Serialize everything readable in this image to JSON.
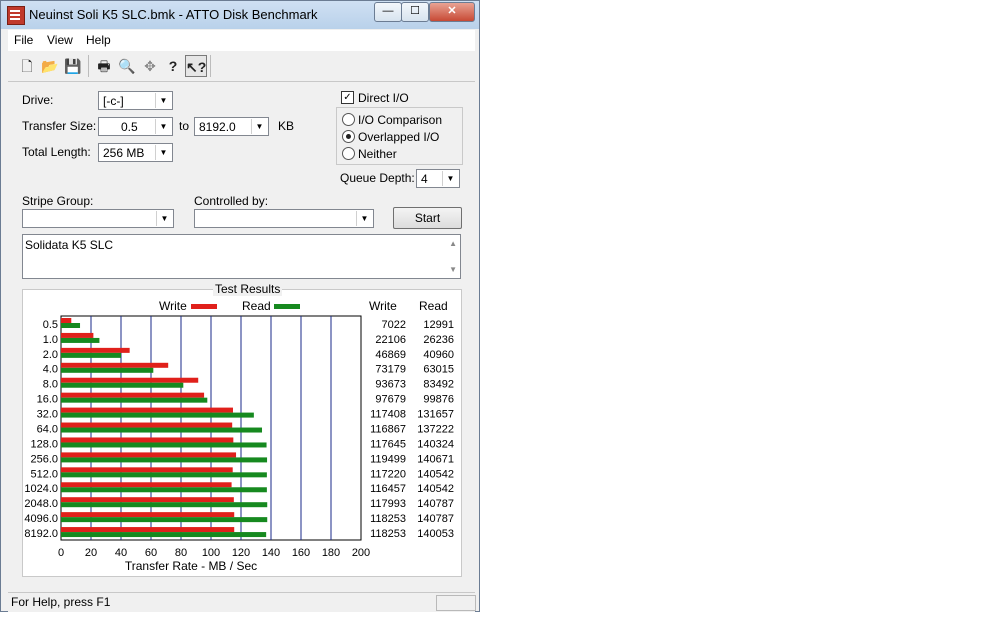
{
  "window": {
    "title": "Neuinst Soli K5 SLC.bmk - ATTO Disk Benchmark",
    "buttons": {
      "minimize": "—",
      "maximize": "☐",
      "close": "✕"
    }
  },
  "menu": [
    "File",
    "View",
    "Help"
  ],
  "toolbar": {
    "icons": [
      "new-icon",
      "open-icon",
      "save-icon",
      "print-icon",
      "print-preview-icon",
      "move-icon",
      "help-icon",
      "context-help-icon"
    ]
  },
  "form": {
    "drive_label": "Drive:",
    "drive_value": "[-c-]",
    "transfer_size_label": "Transfer Size:",
    "transfer_from": "0.5",
    "to_label": "to",
    "transfer_to": "8192.0",
    "kb_label": "KB",
    "total_length_label": "Total Length:",
    "total_length_value": "256 MB",
    "direct_io_label": "Direct I/O",
    "direct_io_checked": true,
    "io_comparison_label": "I/O Comparison",
    "overlapped_io_label": "Overlapped I/O",
    "neither_label": "Neither",
    "selected_mode": "Overlapped I/O",
    "queue_depth_label": "Queue Depth:",
    "queue_depth_value": "4",
    "stripe_group_label": "Stripe Group:",
    "controlled_by_label": "Controlled by:",
    "start_label": "Start",
    "description": "Solidata K5 SLC"
  },
  "results": {
    "title": "Test Results",
    "write_col": "Write",
    "read_col": "Read"
  },
  "chart_data": {
    "type": "bar",
    "orientation": "horizontal",
    "categories": [
      "0.5",
      "1.0",
      "2.0",
      "4.0",
      "8.0",
      "16.0",
      "32.0",
      "64.0",
      "128.0",
      "256.0",
      "512.0",
      "1024.0",
      "2048.0",
      "4096.0",
      "8192.0"
    ],
    "series": [
      {
        "name": "Write",
        "color": "#e0201b",
        "values": [
          7022,
          22106,
          46869,
          73179,
          93673,
          97679,
          117408,
          116867,
          117645,
          119499,
          117220,
          116457,
          117993,
          118253,
          118253
        ]
      },
      {
        "name": "Read",
        "color": "#16891f",
        "values": [
          12991,
          26236,
          40960,
          63015,
          83492,
          99876,
          131657,
          137222,
          140324,
          140671,
          140542,
          140542,
          140787,
          140787,
          140053
        ]
      }
    ],
    "xlabel": "Transfer Rate - MB / Sec",
    "xlim": [
      0,
      200
    ],
    "xticks": [
      "0",
      "20",
      "40",
      "60",
      "80",
      "100",
      "120",
      "140",
      "160",
      "180",
      "200"
    ],
    "legend": "top"
  },
  "status": {
    "text": "For Help, press F1"
  }
}
